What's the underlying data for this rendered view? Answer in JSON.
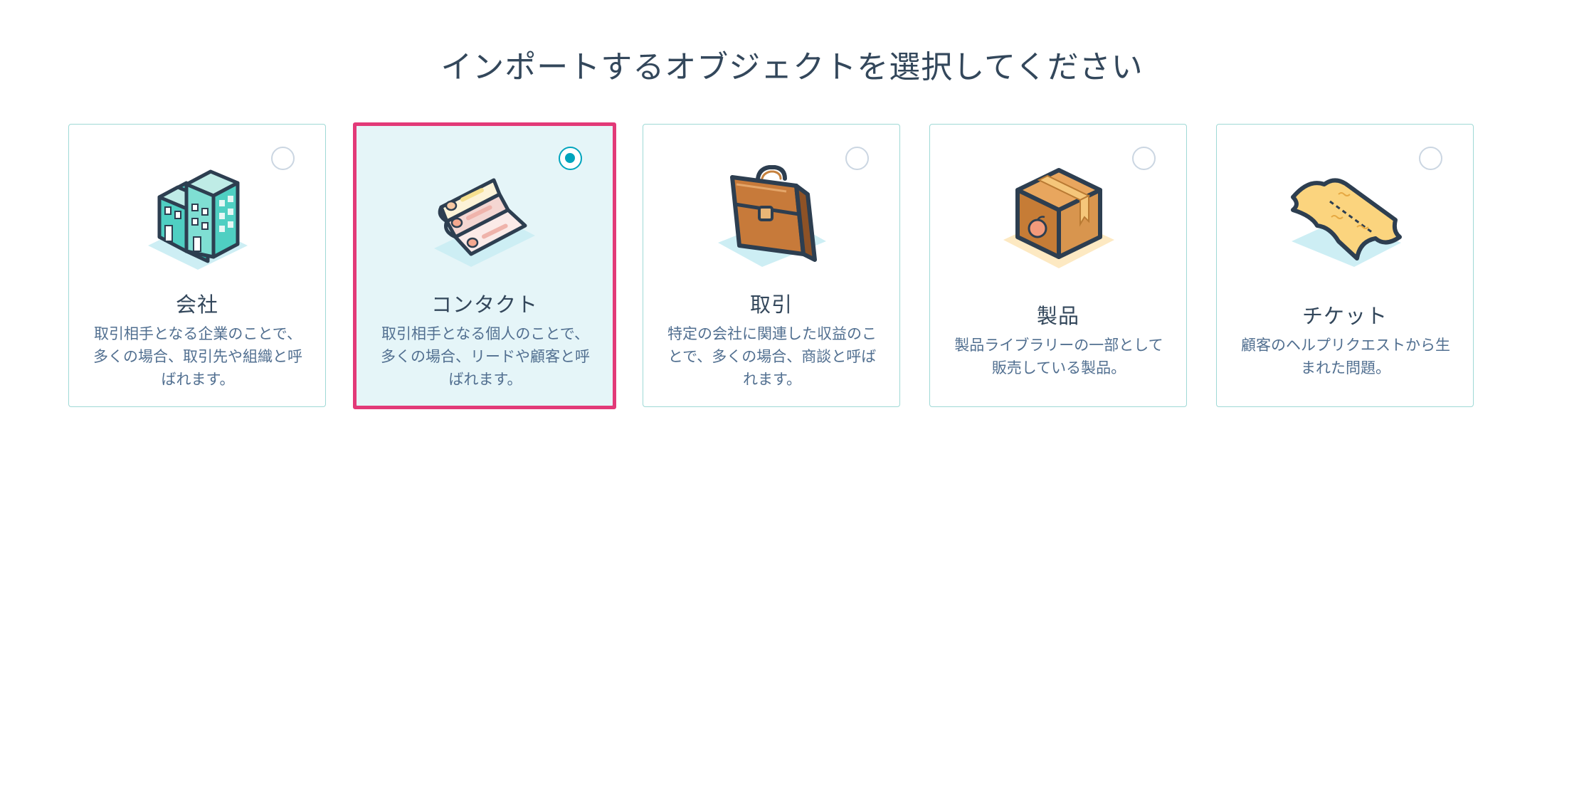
{
  "page_title": "インポートするオブジェクトを選択してください",
  "cards": [
    {
      "title": "会社",
      "description_lines": [
        "取引相手となる企業のことで、",
        "多くの場合、取引先や組織と呼",
        "ばれます。"
      ],
      "selected": false,
      "icon": "building-icon"
    },
    {
      "title": "コンタクト",
      "description_lines": [
        "取引相手となる個人のことで、",
        "多くの場合、リードや顧客と呼",
        "ばれます。"
      ],
      "selected": true,
      "icon": "contact-cards-icon"
    },
    {
      "title": "取引",
      "description_lines": [
        "特定の会社に関連した収益のこ",
        "とで、多くの場合、商談と呼ば",
        "れます。"
      ],
      "selected": false,
      "icon": "briefcase-icon"
    },
    {
      "title": "製品",
      "description_lines": [
        "製品ライブラリーの一部として",
        "販売している製品。"
      ],
      "selected": false,
      "icon": "box-icon"
    },
    {
      "title": "チケット",
      "description_lines": [
        "顧客のヘルプリクエストから生",
        "まれた問題。"
      ],
      "selected": false,
      "icon": "ticket-icon"
    }
  ],
  "colors": {
    "accent": "#00a4bd",
    "card_border": "#9fd9d6",
    "selected_bg": "#e5f5f8",
    "highlight": "#e23a78"
  }
}
